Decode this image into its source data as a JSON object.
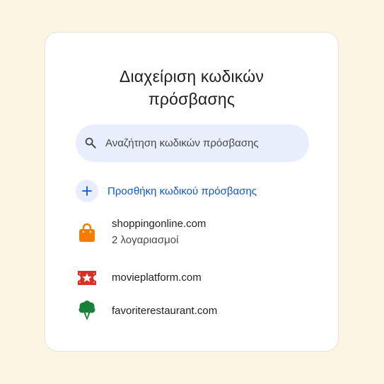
{
  "card": {
    "title_line1": "Διαχείριση κωδικών",
    "title_line2": "πρόσβασης"
  },
  "search": {
    "placeholder": "Αναζήτηση κωδικών πρόσβασης",
    "icon": "search-icon"
  },
  "add_password": {
    "label": "Προσθήκη κωδικού πρόσβασης",
    "icon": "plus-icon"
  },
  "sites": [
    {
      "name": "shoppingonline.com",
      "accounts": "2 λογαριασμοί",
      "icon": "shopping-bag-icon",
      "color": "#f57c00"
    },
    {
      "name": "movieplatform.com",
      "icon": "movie-ticket-icon",
      "color": "#d93025"
    },
    {
      "name": "favoriterestaurant.com",
      "icon": "broccoli-icon",
      "color": "#188038"
    }
  ],
  "colors": {
    "background": "#fdf5e4",
    "accent": "#0b57d0",
    "search_fill": "#e8eefb"
  }
}
